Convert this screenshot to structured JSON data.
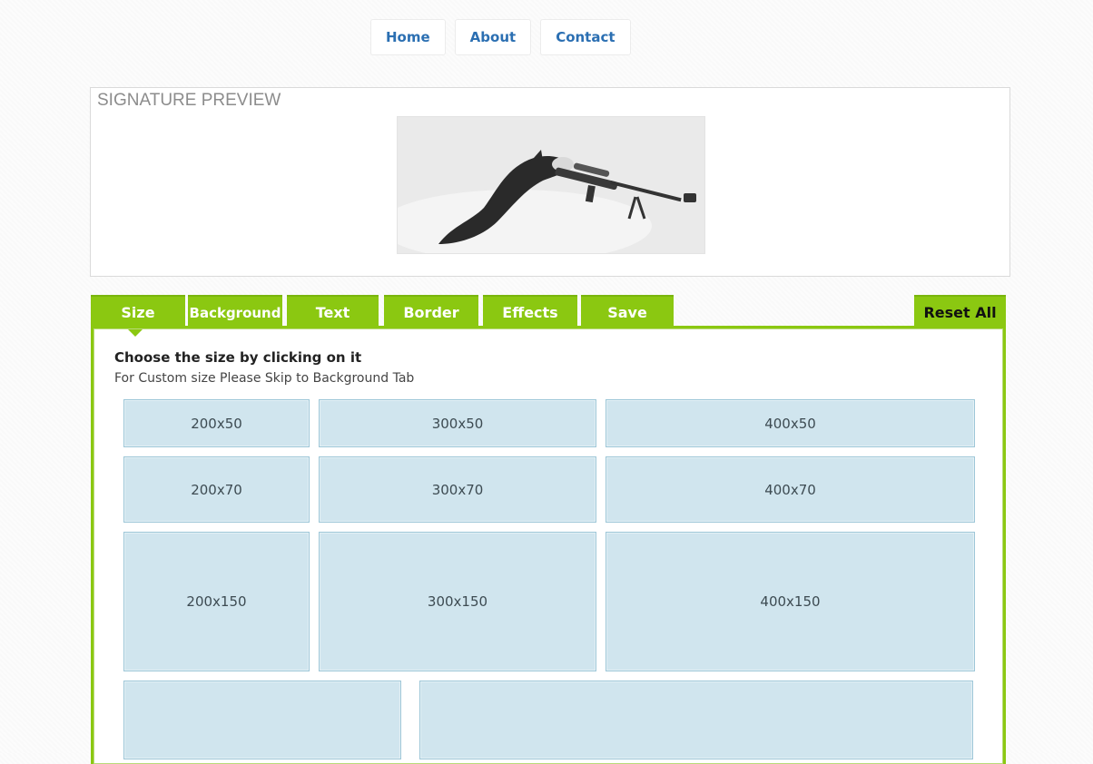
{
  "nav": {
    "home": "Home",
    "about": "About",
    "contact": "Contact"
  },
  "preview": {
    "title": "SIGNATURE PREVIEW"
  },
  "tabs": {
    "size": "Size",
    "background": "Background",
    "text": "Text",
    "border": "Border",
    "effects": "Effects",
    "save": "Save",
    "reset": "Reset All"
  },
  "panel": {
    "heading": "Choose the size by clicking on it",
    "subheading": "For Custom size Please Skip to Background Tab"
  },
  "sizes": {
    "s200x50": "200x50",
    "s300x50": "300x50",
    "s400x50": "400x50",
    "s200x70": "200x70",
    "s300x70": "300x70",
    "s400x70": "400x70",
    "s200x150": "200x150",
    "s300x150": "300x150",
    "s400x150": "400x150",
    "extra_left": "",
    "extra_right": ""
  },
  "colors": {
    "accent": "#8bc811",
    "link": "#2b6fb2",
    "tile": "#d0e5ee",
    "tile_border": "#9ec7d8"
  }
}
